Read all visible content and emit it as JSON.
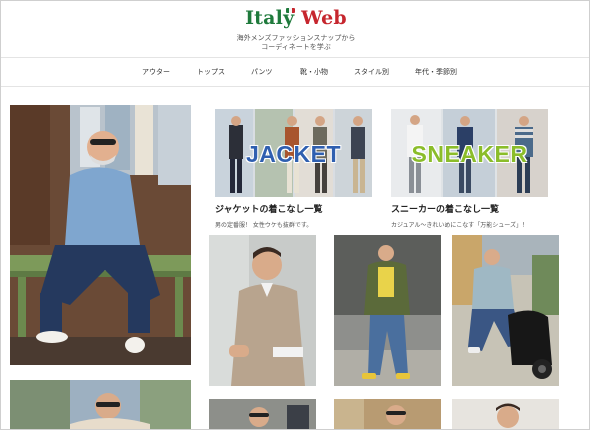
{
  "site": {
    "logo_part1": "Italy",
    "logo_part2": "Web",
    "tagline_line1": "海外メンズファッションスナップから",
    "tagline_line2": "コーディネートを学ぶ"
  },
  "nav": {
    "items": [
      {
        "label": "アウター"
      },
      {
        "label": "トップス"
      },
      {
        "label": "パンツ"
      },
      {
        "label": "靴・小物"
      },
      {
        "label": "スタイル別"
      },
      {
        "label": "年代・季節別"
      }
    ]
  },
  "cards": {
    "jacket": {
      "banner_word": "JACKET",
      "title": "ジャケットの着こなし一覧",
      "desc": "男の定番服！ 女性ウケも抜群です。"
    },
    "sneaker": {
      "banner_word": "SNEAKER",
      "title": "スニーカーの着こなし一覧",
      "desc": "カジュアル～きれいめにこなす「万能シューズ」！"
    }
  },
  "colors": {
    "logo_green": "#1f7a3c",
    "logo_red": "#c6262e",
    "jacket_blue": "#2f5fb0",
    "sneaker_green": "#8bbd2a"
  }
}
